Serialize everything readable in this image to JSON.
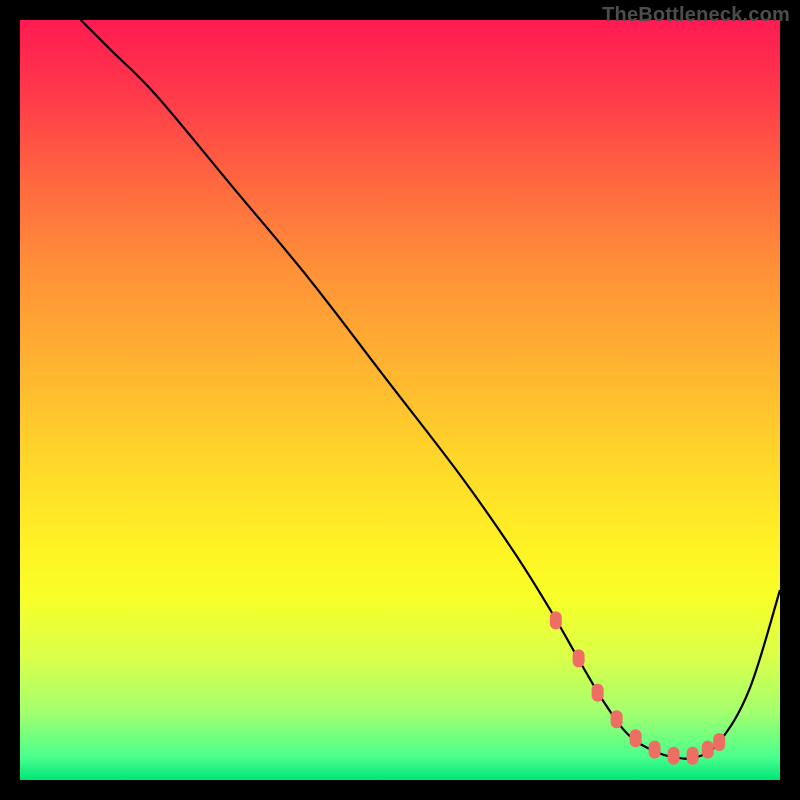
{
  "watermark": "TheBottleneck.com",
  "colors": {
    "frame": "#000000",
    "curve": "#000000",
    "marker_fill": "#ef6e63",
    "marker_stroke": "#ef6e63"
  },
  "chart_data": {
    "type": "line",
    "title": "",
    "xlabel": "",
    "ylabel": "",
    "xlim": [
      0,
      100
    ],
    "ylim": [
      0,
      100
    ],
    "grid": false,
    "legend": false,
    "series": [
      {
        "name": "bottleneck-curve",
        "x": [
          8,
          12,
          18,
          28,
          38,
          48,
          58,
          65,
          70,
          74,
          77,
          80,
          83,
          86,
          89,
          92,
          96,
          100
        ],
        "y": [
          100,
          96,
          90,
          78,
          66,
          53,
          40,
          30,
          22,
          15,
          10,
          6,
          4,
          3,
          3,
          5,
          12,
          25
        ]
      }
    ],
    "markers": {
      "name": "highlight-range",
      "x": [
        70.5,
        73.5,
        76,
        78.5,
        81,
        83.5,
        86,
        88.5,
        90.5,
        92
      ],
      "y": [
        21,
        16,
        11.5,
        8,
        5.5,
        4,
        3.2,
        3.2,
        4,
        5
      ]
    }
  }
}
